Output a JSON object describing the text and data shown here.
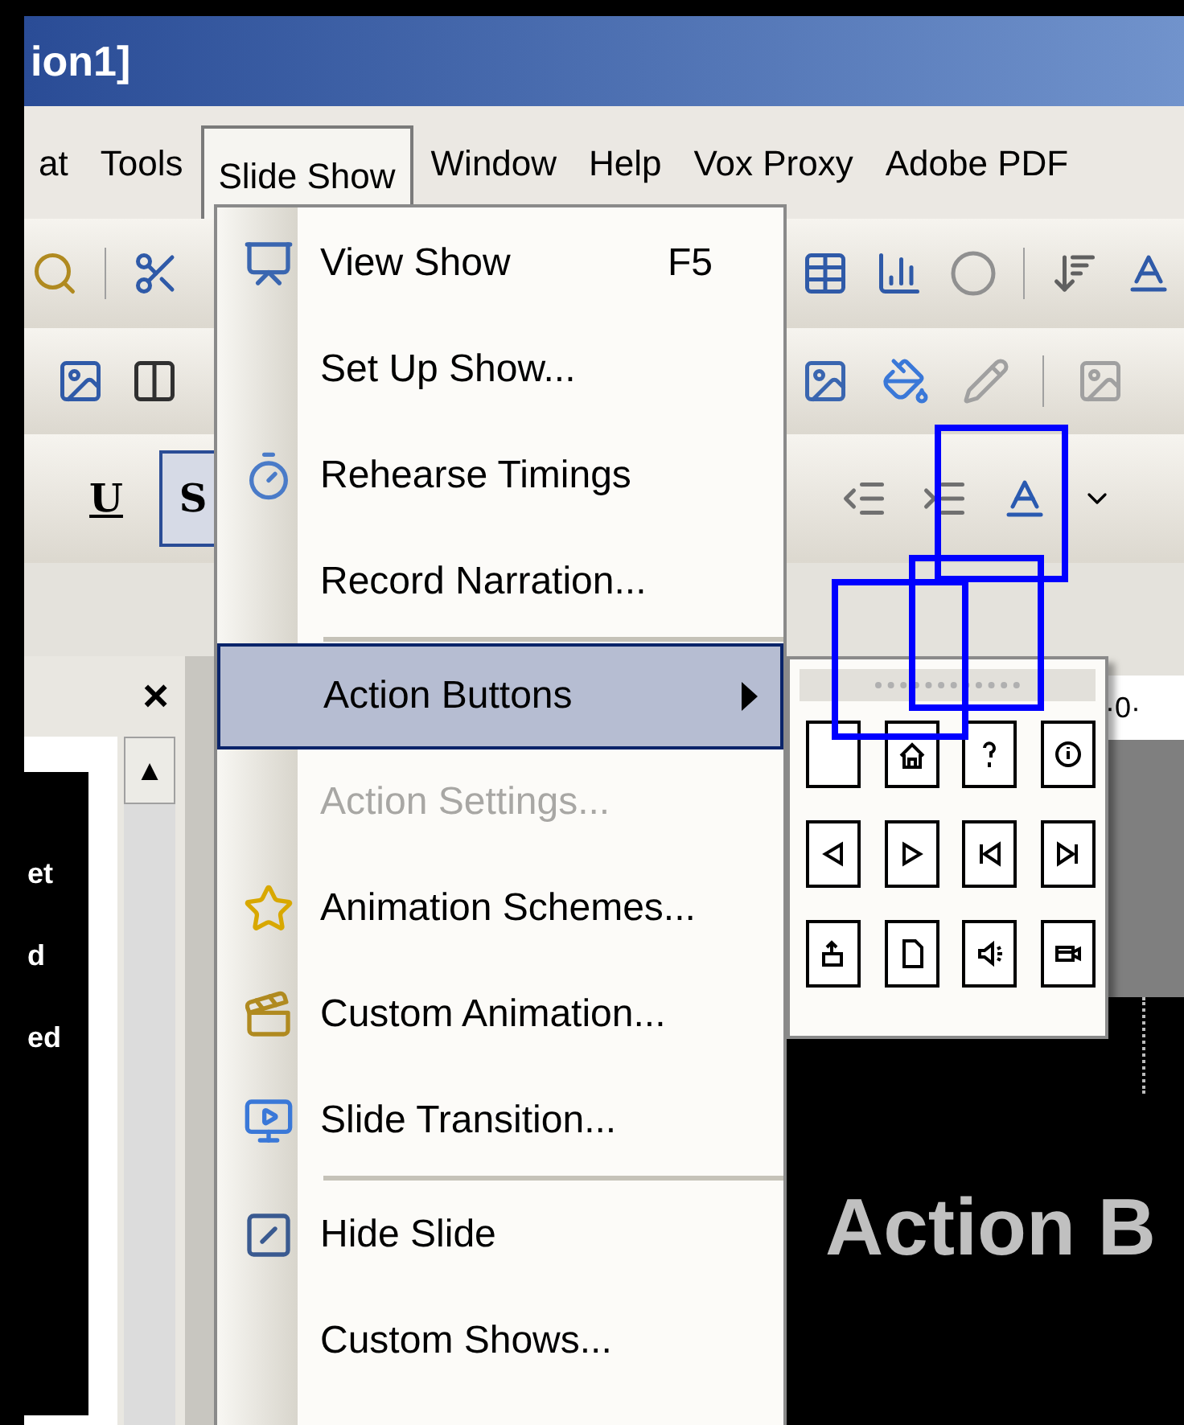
{
  "window": {
    "title": "ion1]"
  },
  "menu_bar": [
    {
      "label": "at",
      "selected": false
    },
    {
      "label": "Tools",
      "selected": false
    },
    {
      "label": "Slide Show",
      "selected": true
    },
    {
      "label": "Window",
      "selected": false
    },
    {
      "label": "Help",
      "selected": false
    },
    {
      "label": "Vox Proxy",
      "selected": false
    },
    {
      "label": "Adobe PDF",
      "selected": false
    }
  ],
  "formatting_toolbar": [
    {
      "label": "U",
      "pressed": false
    },
    {
      "label": "S",
      "pressed": true
    }
  ],
  "task_pane": {
    "close": "×",
    "scroll_up": "▲",
    "thumbnail_text": [
      "et",
      "d",
      "ed"
    ]
  },
  "ruler": {
    "label": "·0·"
  },
  "slide": {
    "title": "Action B"
  },
  "slide_show_menu": [
    {
      "label": "View Show",
      "shortcut": "F5",
      "disabled": false,
      "selected": false,
      "submenu": false,
      "separator_before": false
    },
    {
      "label": "Set Up Show...",
      "disabled": false,
      "selected": false,
      "submenu": false,
      "separator_before": false
    },
    {
      "label": "Rehearse Timings",
      "disabled": false,
      "selected": false,
      "submenu": false,
      "separator_before": false
    },
    {
      "label": "Record Narration...",
      "disabled": false,
      "selected": false,
      "submenu": false,
      "separator_before": false
    },
    {
      "label": "Action Buttons",
      "disabled": false,
      "selected": true,
      "submenu": true,
      "separator_before": true
    },
    {
      "label": "Action Settings...",
      "disabled": true,
      "selected": false,
      "submenu": false,
      "separator_before": false
    },
    {
      "label": "Animation Schemes...",
      "disabled": false,
      "selected": false,
      "submenu": false,
      "separator_before": false
    },
    {
      "label": "Custom Animation...",
      "disabled": false,
      "selected": false,
      "submenu": false,
      "separator_before": false
    },
    {
      "label": "Slide Transition...",
      "disabled": false,
      "selected": false,
      "submenu": false,
      "separator_before": false
    },
    {
      "label": "Hide Slide",
      "disabled": false,
      "selected": false,
      "submenu": false,
      "separator_before": true
    },
    {
      "label": "Custom Shows...",
      "disabled": false,
      "selected": false,
      "submenu": false,
      "separator_before": false
    }
  ]
}
